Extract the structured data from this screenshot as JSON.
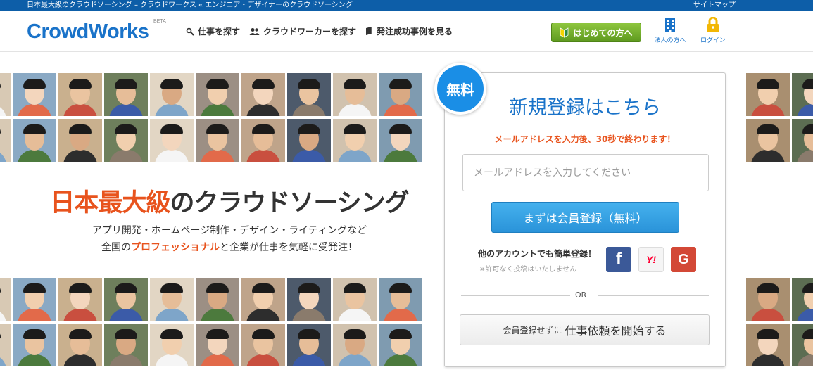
{
  "topbar": {
    "tagline": "日本最大級のクラウドソーシング – クラウドワークス « エンジニア・デザイナーのクラウドソーシング",
    "sitemap": "サイトマップ"
  },
  "header": {
    "logo": "CrowdWorks",
    "beta": "BETA",
    "nav": [
      {
        "label": "仕事を探す",
        "icon": "search-icon"
      },
      {
        "label": "クラウドワーカーを探す",
        "icon": "people-icon"
      },
      {
        "label": "発注成功事例を見る",
        "icon": "book-icon"
      }
    ],
    "start_button": "はじめての方へ",
    "corporate_label": "法人の方へ",
    "login_label": "ログイン"
  },
  "hero": {
    "headline_highlight": "日本最大級",
    "headline_rest": "のクラウドソーシング",
    "sub_line1": "アプリ開発・ホームページ制作・デザイン・ライティングなど",
    "sub_line2_prefix": "全国の",
    "sub_line2_pro": "プロフェッショナル",
    "sub_line2_suffix": "と企業が仕事を気軽に受発注！"
  },
  "signup": {
    "badge": "無料",
    "title": "新規登録はこちら",
    "note": "メールアドレスを入力後、30秒で終わります！",
    "email_placeholder": "メールアドレスを入力してください",
    "register_button": "まずは会員登録（無料）",
    "social_text": "他のアカウントでも簡単登録！",
    "social_note": "※許可なく投稿はいたしません",
    "facebook_glyph": "f",
    "yahoo_glyph": "Y!",
    "google_glyph": "G",
    "or_text": "OR",
    "job_button_small": "会員登録せずに",
    "job_button_big": "仕事依頼を開始する"
  },
  "colors": {
    "brand_blue": "#1a73c9",
    "accent_orange": "#e8531d",
    "start_green": "#6fae2b",
    "register_blue": "#2a93d9",
    "facebook": "#3b5998",
    "yahoo": "#ff0033",
    "google": "#d34836"
  }
}
